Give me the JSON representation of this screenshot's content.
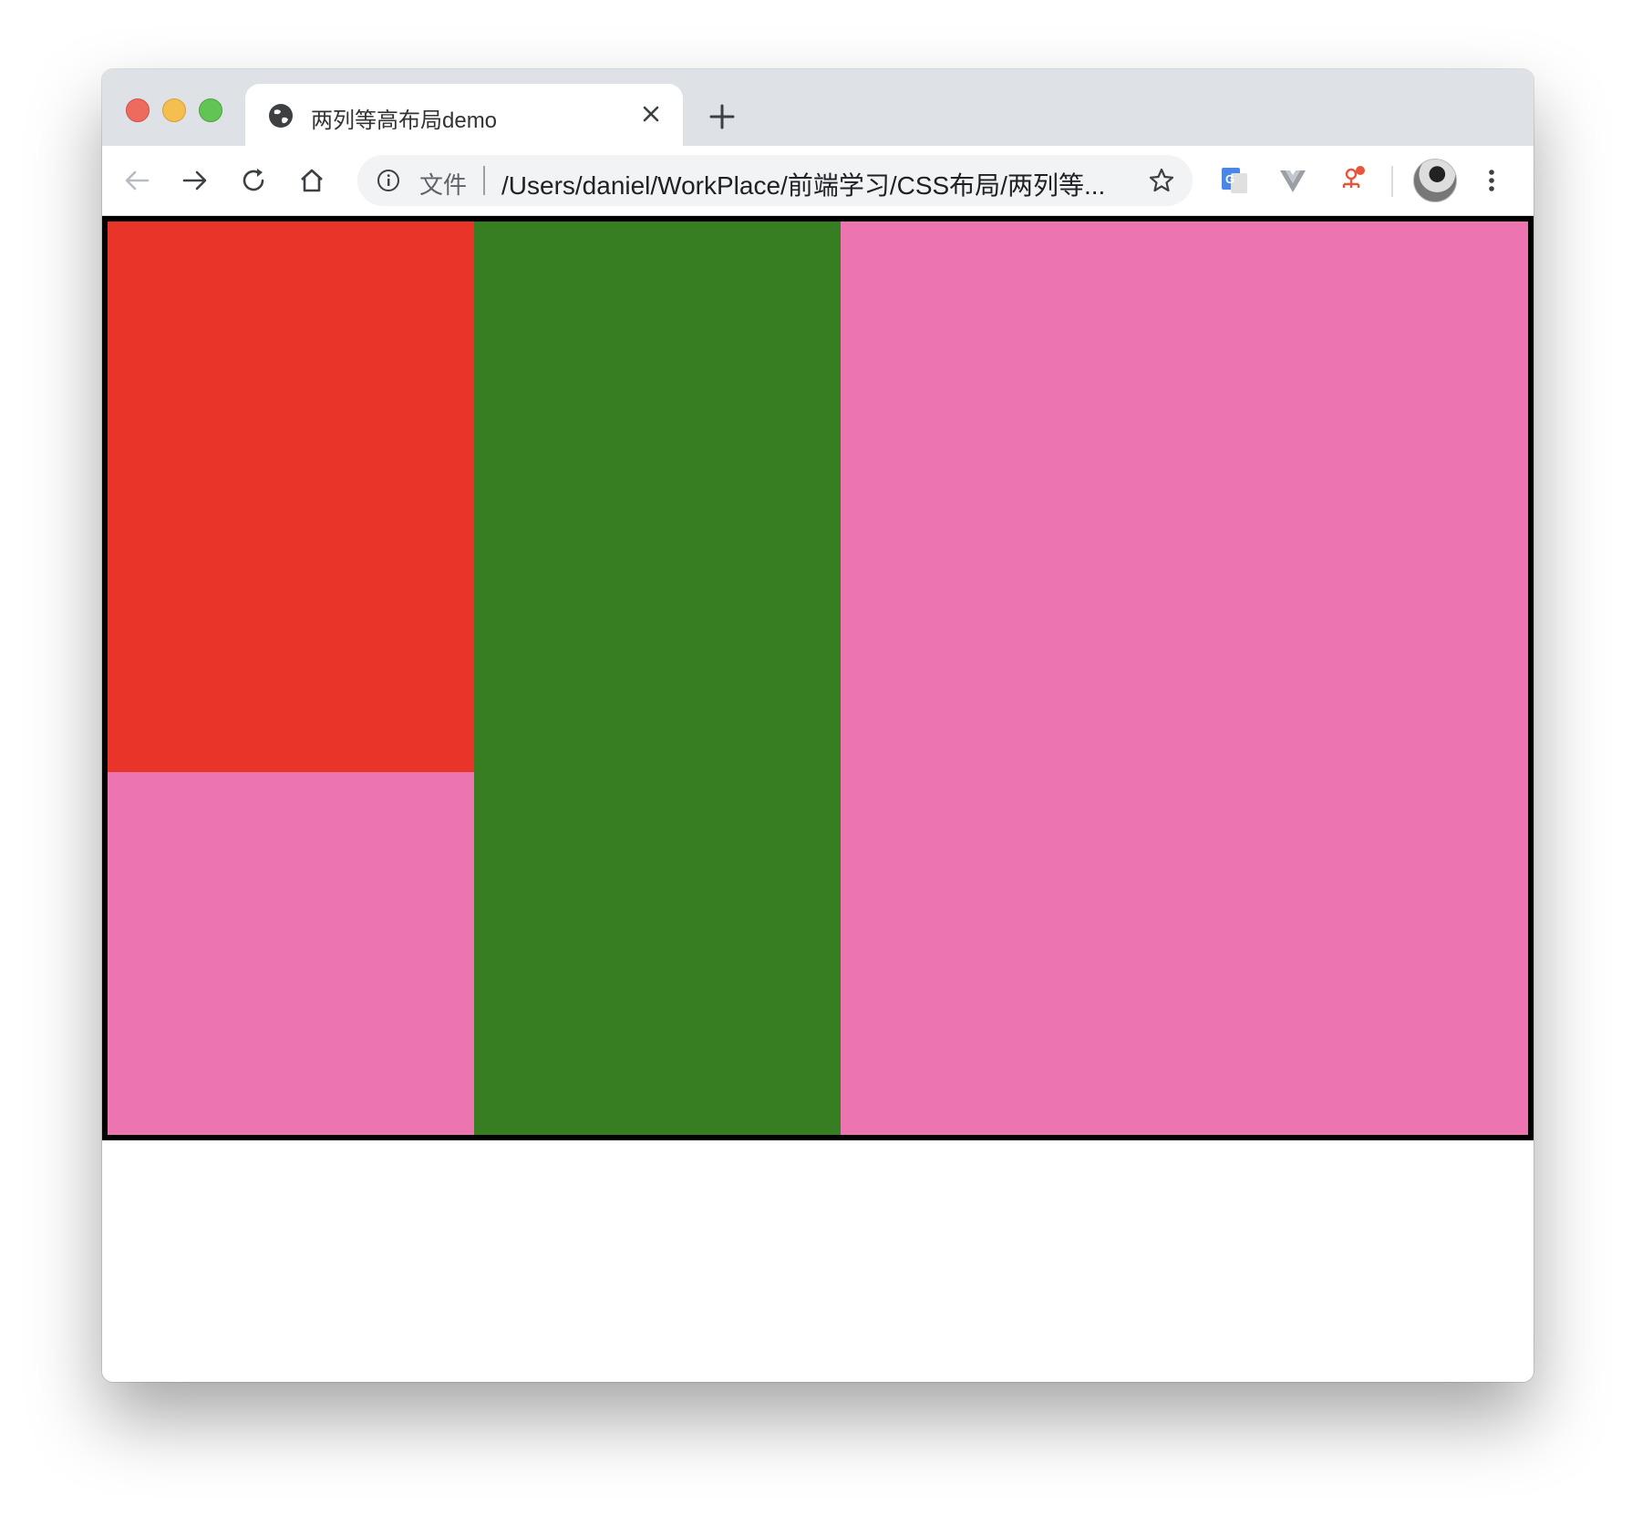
{
  "tab": {
    "title": "两列等高布局demo"
  },
  "omnibox": {
    "scheme_label": "文件",
    "url": "/Users/daniel/WorkPlace/前端学习/CSS布局/两列等..."
  },
  "icons": {
    "favicon": "globe-icon",
    "tab_close": "close-icon",
    "new_tab": "plus-icon",
    "back": "back-arrow-icon",
    "forward": "forward-arrow-icon",
    "reload": "reload-icon",
    "home": "home-icon",
    "site_info": "info-icon",
    "bookmark": "star-icon",
    "extension_translate": "google-translate-icon",
    "extension_vue": "vue-devtools-icon",
    "extension_third": "extension-icon",
    "menu": "kebab-menu-icon"
  },
  "colors": {
    "left_top": "#e9342a",
    "left_bottom": "#ec74b0",
    "middle": "#377d22",
    "right": "#ec74b0",
    "container_border": "#000000"
  }
}
